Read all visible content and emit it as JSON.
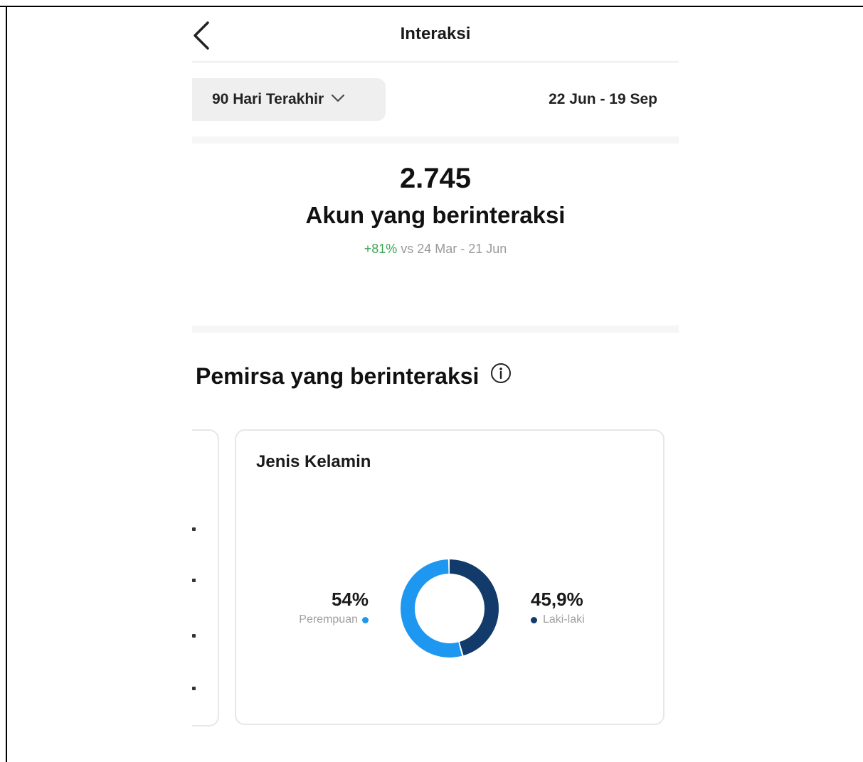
{
  "header": {
    "title": "Interaksi"
  },
  "filter": {
    "range_label": "90 Hari Terakhir",
    "date_range": "22 Jun - 19 Sep"
  },
  "summary": {
    "value": "2.745",
    "label": "Akun yang berinteraksi",
    "change": "+81%",
    "comparison": "vs 24 Mar - 21 Jun"
  },
  "audience": {
    "title": "Pemirsa yang berinteraksi"
  },
  "gender_card": {
    "title": "Jenis Kelamin",
    "female": {
      "value": "54%",
      "label": "Perempuan",
      "color": "#1e97f0"
    },
    "male": {
      "value": "45,9%",
      "label": "Laki-laki",
      "color": "#123a6b"
    }
  },
  "chart_data": {
    "type": "pie",
    "title": "Jenis Kelamin",
    "categories": [
      "Perempuan",
      "Laki-laki"
    ],
    "values": [
      54,
      45.9
    ],
    "colors": [
      "#1e97f0",
      "#123a6b"
    ],
    "donut": true
  },
  "colors": {
    "positive": "#3fa456",
    "muted": "#9a9a9a"
  }
}
